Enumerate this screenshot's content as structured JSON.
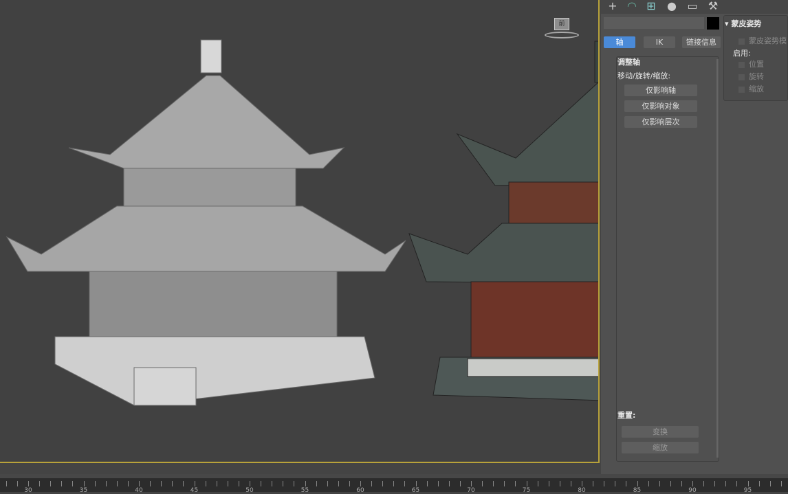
{
  "toolbar": {
    "icons": [
      "create-icon",
      "modify-icon",
      "hierarchy-icon",
      "motion-icon",
      "display-icon",
      "utilities-icon"
    ]
  },
  "panel": {
    "tabs": {
      "pivot": "轴",
      "ik": "IK",
      "link_info": "链接信息"
    },
    "adjust_pivot": {
      "title": "调整轴",
      "subtitle": "移动/旋转/缩放:",
      "affect_pivot": "仅影响轴",
      "affect_object": "仅影响对象",
      "affect_hierarchy": "仅影响层次"
    },
    "reset": {
      "title": "重置:",
      "transform": "变换",
      "scale": "缩放"
    },
    "skin_pose": {
      "title": "蒙皮姿势",
      "mode": "蒙皮姿势模",
      "enable": "启用:",
      "position": "位置",
      "rotation": "旋转",
      "scale": "缩放"
    },
    "active_color": "#1a73e8"
  },
  "viewcube": {
    "label": "前"
  },
  "ruler": {
    "ticks": [
      30,
      35,
      40,
      45,
      50,
      55,
      60,
      65,
      70,
      75,
      80,
      85,
      90,
      95
    ]
  }
}
